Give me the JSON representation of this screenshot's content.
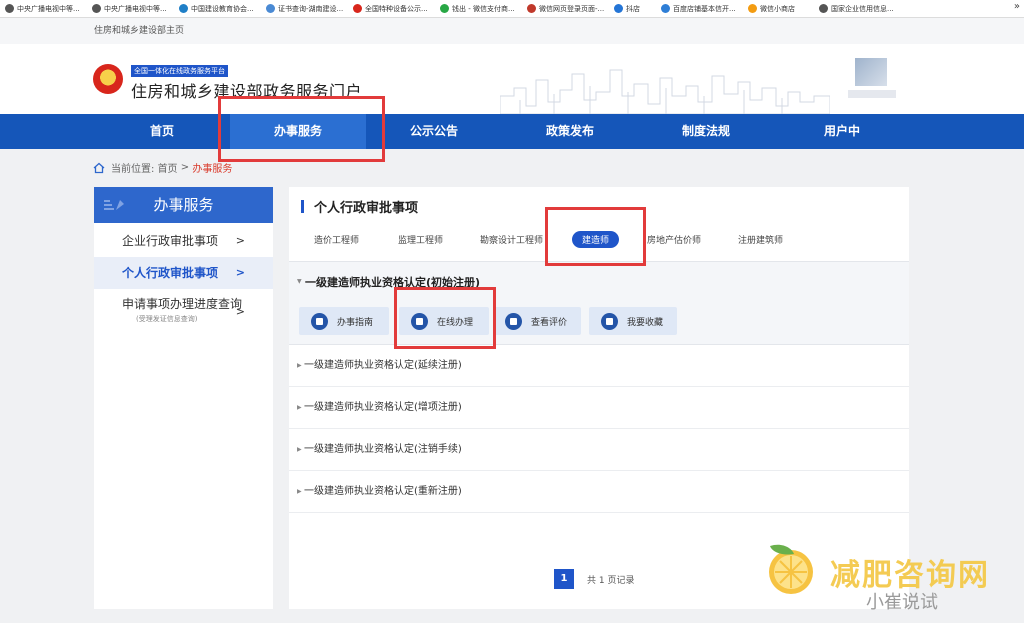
{
  "browser": {
    "bookmarks": [
      "中央广播电视中等...",
      "中央广播电视中等...",
      "中国建设教育协会...",
      "证书查询-湖南建设...",
      "全国特种设备公示...",
      "钱出 - 微信支付商...",
      "微信网页登录页面-...",
      "抖店",
      "百度店铺基本信开...",
      "微信小商店",
      "国家企业信用信息..."
    ],
    "more": "»"
  },
  "topstrip": {
    "label": "住房和城乡建设部主页"
  },
  "header": {
    "badge": "全国一体化在线政务服务平台",
    "title": "住房和城乡建设部政务服务门户"
  },
  "nav": {
    "items": [
      "首页",
      "办事服务",
      "公示公告",
      "政策发布",
      "制度法规",
      "用户中"
    ],
    "active_index": 1
  },
  "breadcrumb": {
    "prefix": "当前位置:",
    "home": "首页",
    "sep": ">",
    "current": "办事服务"
  },
  "sidebar": {
    "title": "办事服务",
    "items": [
      {
        "label": "企业行政审批事项",
        "chev": ">"
      },
      {
        "label": "个人行政审批事项",
        "chev": ">"
      },
      {
        "label": "申请事项办理进度查询",
        "sub": "(受理发证信息查询)",
        "chev": ">"
      }
    ]
  },
  "main": {
    "title": "个人行政审批事项",
    "tabs": [
      "造价工程师",
      "监理工程师",
      "勘察设计工程师",
      "建造师",
      "房地产估价师",
      "注册建筑师"
    ],
    "active_tab_index": 3,
    "group": {
      "title": "一级建造师执业资格认定(初始注册)",
      "actions": [
        "办事指南",
        "在线办理",
        "查看评价",
        "我要收藏"
      ]
    },
    "rows": [
      "一级建造师执业资格认定(延续注册)",
      "一级建造师执业资格认定(增项注册)",
      "一级建造师执业资格认定(注销手续)",
      "一级建造师执业资格认定(重新注册)"
    ],
    "pager": {
      "page": "1",
      "summary": "共 1 页记录"
    }
  },
  "watermark": {
    "text": "减肥咨询网",
    "sub": "小崔说试"
  },
  "colors": {
    "nav": "#1556b9",
    "accent": "#1f55c9",
    "highlight_box": "#e23b3b"
  }
}
